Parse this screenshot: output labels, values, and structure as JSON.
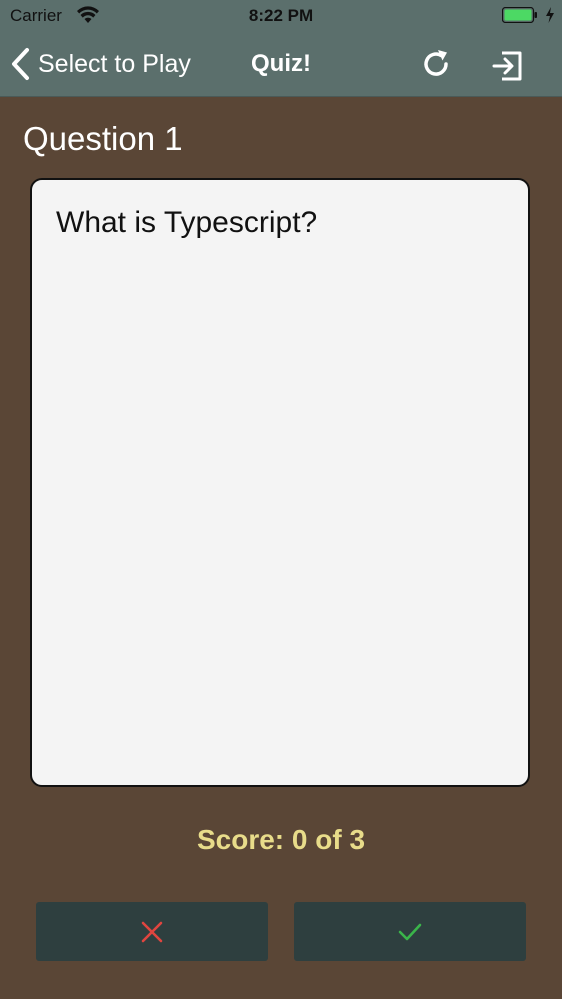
{
  "status_bar": {
    "carrier": "Carrier",
    "time": "8:22 PM"
  },
  "nav": {
    "back_label": "Select to Play",
    "title": "Quiz!"
  },
  "question": {
    "label": "Question 1",
    "text": "What is Typescript?"
  },
  "score": {
    "text": "Score: 0 of 3"
  },
  "icons": {
    "back": "chevron-left-icon",
    "refresh": "refresh-icon",
    "exit": "exit-icon",
    "wrong": "close-icon",
    "correct": "check-icon",
    "wifi": "wifi-icon",
    "battery": "battery-icon"
  },
  "colors": {
    "background": "#5a4636",
    "nav_bar": "#5b6f6c",
    "card": "#f4f4f4",
    "score": "#e8dc8a",
    "button": "#2e3f3f",
    "wrong": "#e0453f",
    "correct": "#3ab54a"
  }
}
